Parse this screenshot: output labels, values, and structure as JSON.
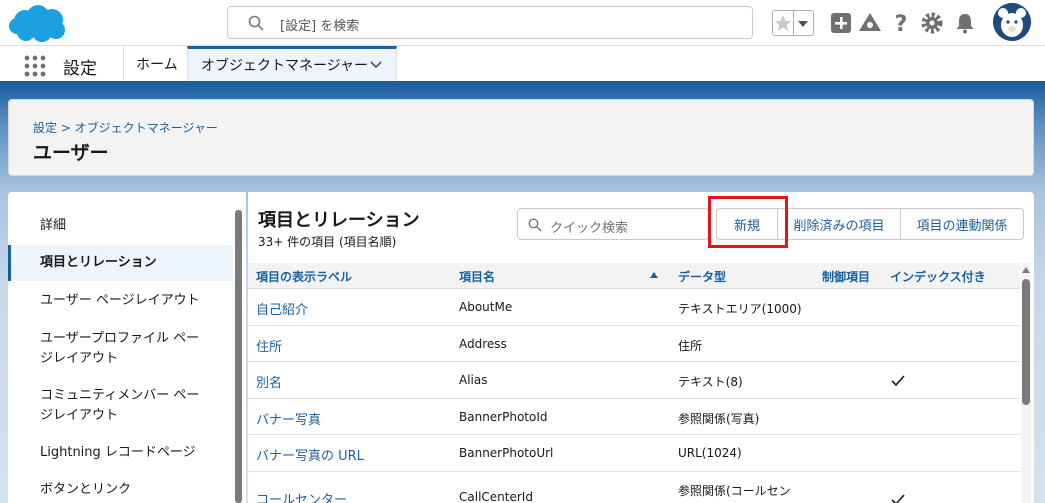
{
  "header": {
    "search_placeholder": "[設定] を検索",
    "brand_color": "#1b5f9e"
  },
  "nav": {
    "app_name": "設定",
    "tabs": [
      {
        "label": "ホーム"
      },
      {
        "label": "オブジェクトマネージャー"
      }
    ]
  },
  "page_header": {
    "breadcrumb": "設定 > オブジェクトマネージャー",
    "title": "ユーザー"
  },
  "sidebar": {
    "items": [
      {
        "label": "詳細"
      },
      {
        "label": "項目とリレーション"
      },
      {
        "label": "ユーザー ページレイアウト"
      },
      {
        "label_line1": "ユーザープロファイル ペー",
        "label_line2": "ジレイアウト"
      },
      {
        "label_line1": "コミュニティメンバー ペー",
        "label_line2": "ジレイアウト"
      },
      {
        "label": "Lightning レコードページ"
      },
      {
        "label": "ボタンとリンク"
      }
    ]
  },
  "main": {
    "title": "項目とリレーション",
    "subtitle": "33+ 件の項目 (項目名順)",
    "quick_search_placeholder": "クイック検索",
    "buttons": {
      "new": "新規",
      "deleted": "削除済みの項目",
      "dependencies": "項目の連動関係"
    },
    "columns": [
      "項目の表示ラベル",
      "項目名",
      "データ型",
      "制御項目",
      "インデックス付き"
    ],
    "rows": [
      {
        "label": "自己紹介",
        "name": "AboutMe",
        "type": "テキストエリア(1000)",
        "indexed": false
      },
      {
        "label": "住所",
        "name": "Address",
        "type": "住所",
        "indexed": false
      },
      {
        "label": "別名",
        "name": "Alias",
        "type": "テキスト(8)",
        "indexed": true
      },
      {
        "label": "バナー写真",
        "name": "BannerPhotoId",
        "type": "参照関係(写真)",
        "indexed": false
      },
      {
        "label": "バナー写真の URL",
        "name": "BannerPhotoUrl",
        "type": "URL(1024)",
        "indexed": false
      },
      {
        "label": "コールセンター",
        "name": "CallCenterId",
        "type": "参照関係(コールセン",
        "indexed": true
      }
    ]
  }
}
